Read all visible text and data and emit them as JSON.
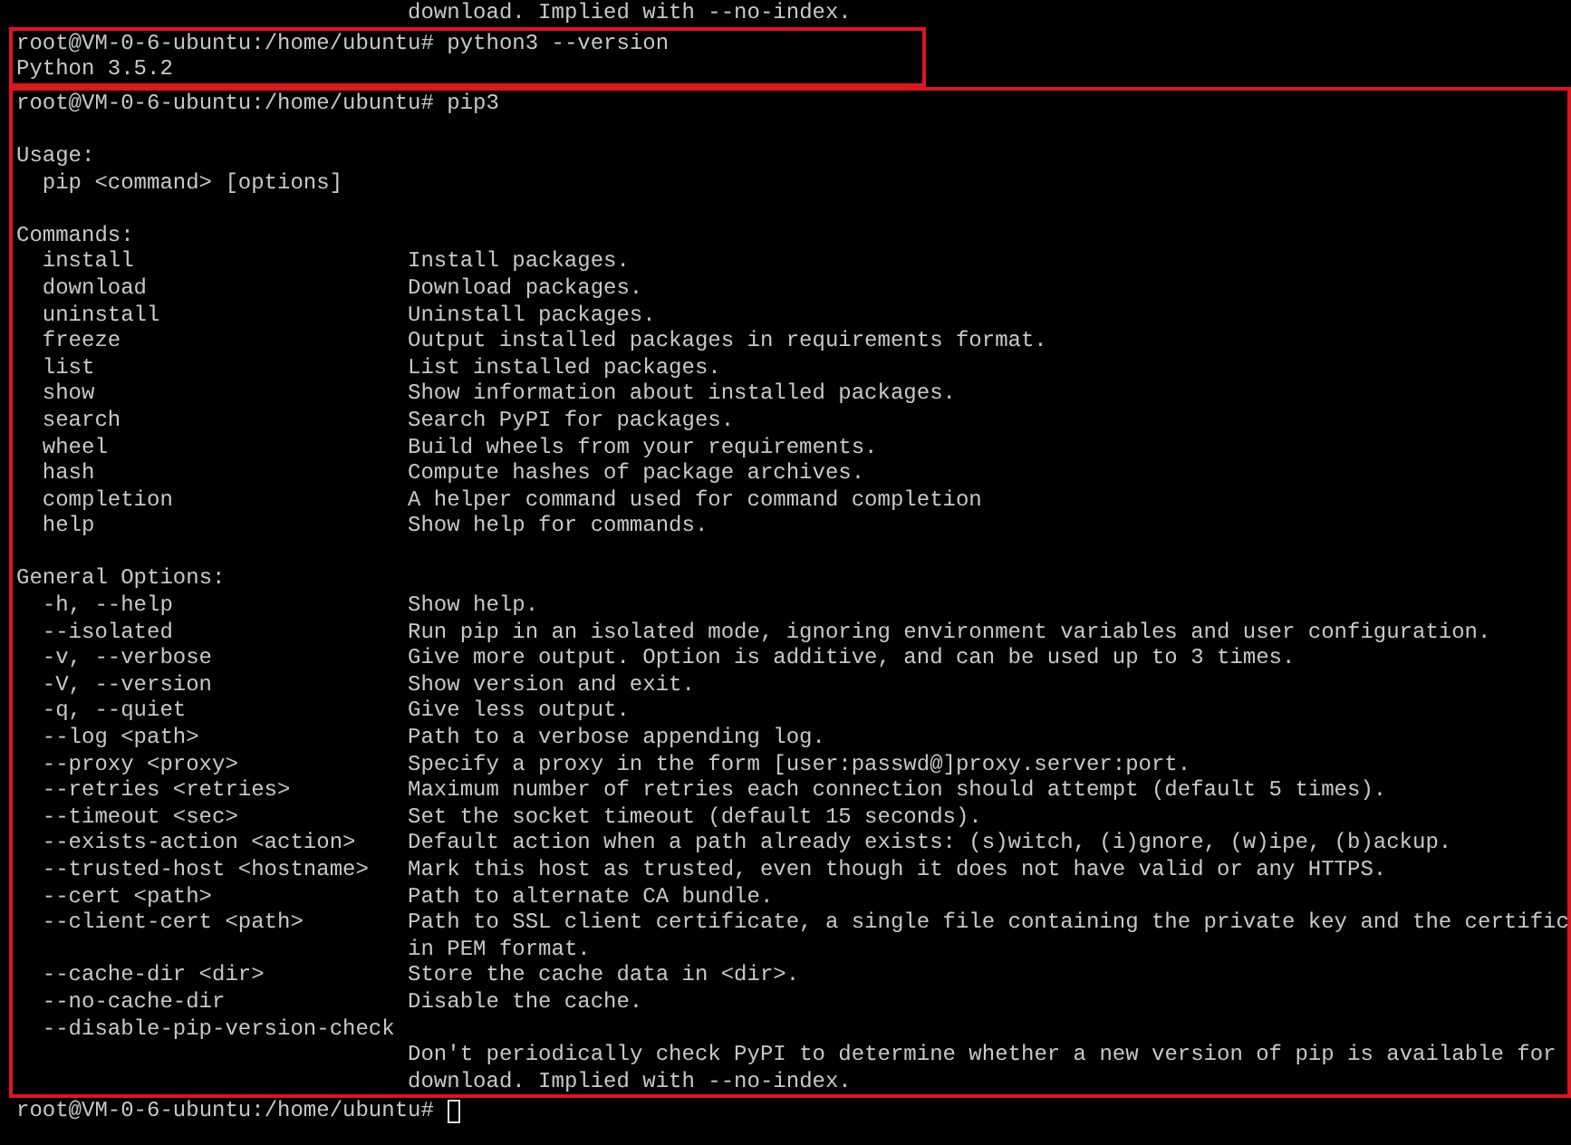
{
  "terminal": {
    "groups": [
      {
        "highlighted": false,
        "lines": [
          {
            "kind": "cont",
            "text": "download. Implied with --no-index."
          }
        ]
      },
      {
        "highlighted": true,
        "lines": [
          {
            "kind": "prompt",
            "text": "root@VM-0-6-ubuntu:/home/ubuntu# python3 --version"
          },
          {
            "kind": "text",
            "text": "Python 3.5.2"
          }
        ]
      },
      {
        "highlighted": true,
        "lines": [
          {
            "kind": "prompt",
            "text": "root@VM-0-6-ubuntu:/home/ubuntu# pip3"
          },
          {
            "kind": "blank"
          },
          {
            "kind": "text",
            "text": "Usage:"
          },
          {
            "kind": "item",
            "key": "pip <command> [options]"
          },
          {
            "kind": "blank"
          },
          {
            "kind": "text",
            "text": "Commands:"
          },
          {
            "kind": "item",
            "key": "install",
            "desc": "Install packages."
          },
          {
            "kind": "item",
            "key": "download",
            "desc": "Download packages."
          },
          {
            "kind": "item",
            "key": "uninstall",
            "desc": "Uninstall packages."
          },
          {
            "kind": "item",
            "key": "freeze",
            "desc": "Output installed packages in requirements format."
          },
          {
            "kind": "item",
            "key": "list",
            "desc": "List installed packages."
          },
          {
            "kind": "item",
            "key": "show",
            "desc": "Show information about installed packages."
          },
          {
            "kind": "item",
            "key": "search",
            "desc": "Search PyPI for packages."
          },
          {
            "kind": "item",
            "key": "wheel",
            "desc": "Build wheels from your requirements."
          },
          {
            "kind": "item",
            "key": "hash",
            "desc": "Compute hashes of package archives."
          },
          {
            "kind": "item",
            "key": "completion",
            "desc": "A helper command used for command completion"
          },
          {
            "kind": "item",
            "key": "help",
            "desc": "Show help for commands."
          },
          {
            "kind": "blank"
          },
          {
            "kind": "text",
            "text": "General Options:"
          },
          {
            "kind": "item",
            "key": "-h, --help",
            "desc": "Show help."
          },
          {
            "kind": "item",
            "key": "--isolated",
            "desc": "Run pip in an isolated mode, ignoring environment variables and user configuration."
          },
          {
            "kind": "item",
            "key": "-v, --verbose",
            "desc": "Give more output. Option is additive, and can be used up to 3 times."
          },
          {
            "kind": "item",
            "key": "-V, --version",
            "desc": "Show version and exit."
          },
          {
            "kind": "item",
            "key": "-q, --quiet",
            "desc": "Give less output."
          },
          {
            "kind": "item",
            "key": "--log <path>",
            "desc": "Path to a verbose appending log."
          },
          {
            "kind": "item",
            "key": "--proxy <proxy>",
            "desc": "Specify a proxy in the form [user:passwd@]proxy.server:port."
          },
          {
            "kind": "item",
            "key": "--retries <retries>",
            "desc": "Maximum number of retries each connection should attempt (default 5 times)."
          },
          {
            "kind": "item",
            "key": "--timeout <sec>",
            "desc": "Set the socket timeout (default 15 seconds)."
          },
          {
            "kind": "item",
            "key": "--exists-action <action>",
            "desc": "Default action when a path already exists: (s)witch, (i)gnore, (w)ipe, (b)ackup."
          },
          {
            "kind": "item",
            "key": "--trusted-host <hostname>",
            "desc": "Mark this host as trusted, even though it does not have valid or any HTTPS."
          },
          {
            "kind": "item",
            "key": "--cert <path>",
            "desc": "Path to alternate CA bundle."
          },
          {
            "kind": "item",
            "key": "--client-cert <path>",
            "desc": "Path to SSL client certificate, a single file containing the private key and the certific"
          },
          {
            "kind": "cont",
            "text": "in PEM format."
          },
          {
            "kind": "item",
            "key": "--cache-dir <dir>",
            "desc": "Store the cache data in <dir>."
          },
          {
            "kind": "item",
            "key": "--no-cache-dir",
            "desc": "Disable the cache."
          },
          {
            "kind": "item",
            "key": "--disable-pip-version-check"
          },
          {
            "kind": "cont",
            "text": "Don't periodically check PyPI to determine whether a new version of pip is available for"
          },
          {
            "kind": "cont",
            "text": "download. Implied with --no-index."
          }
        ]
      },
      {
        "highlighted": false,
        "lines": [
          {
            "kind": "prompt",
            "text": "root@VM-0-6-ubuntu:/home/ubuntu#",
            "cursor": true
          }
        ]
      }
    ]
  }
}
